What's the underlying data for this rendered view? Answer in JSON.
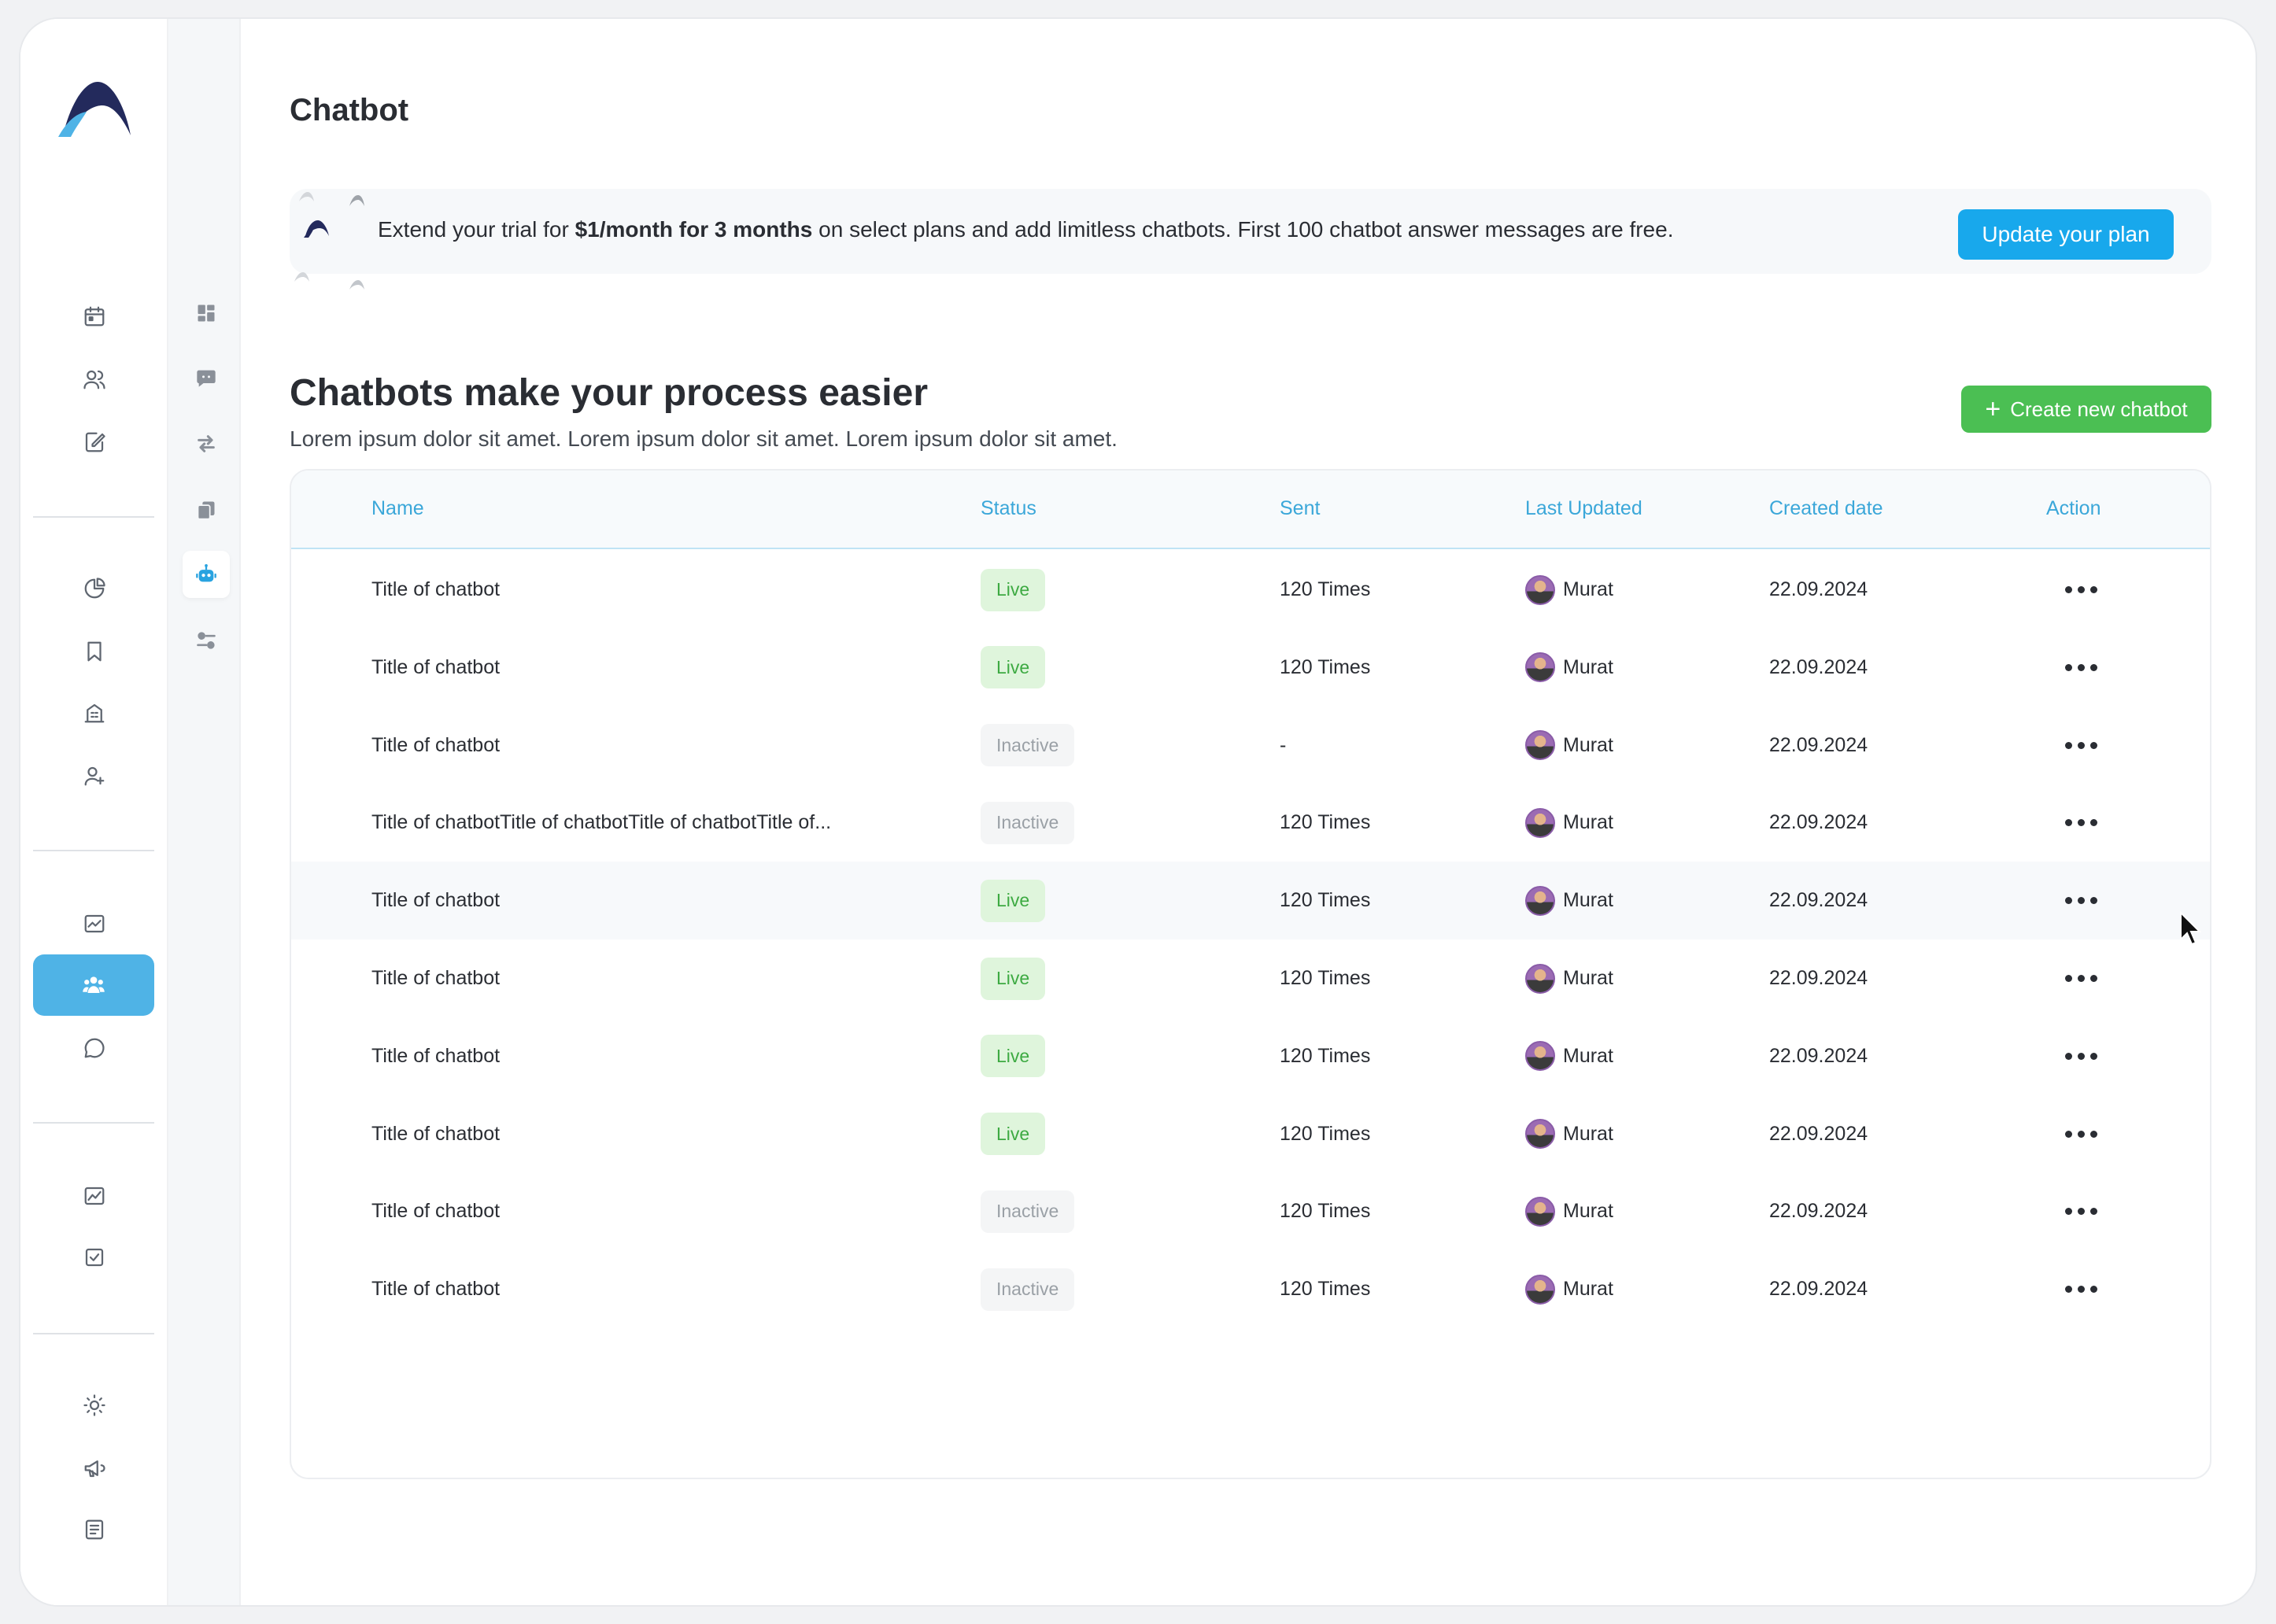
{
  "page": {
    "title": "Chatbot"
  },
  "banner": {
    "text_pre": "Extend your trial for ",
    "text_bold": "$1/month for 3 months",
    "text_post": " on select plans and add limitless chatbots. First 100 chatbot answer messages are free.",
    "button_label": "Update your plan"
  },
  "section": {
    "title": "Chatbots make your process easier",
    "subtitle": "Lorem ipsum dolor sit amet. Lorem ipsum dolor sit amet. Lorem ipsum dolor sit amet.",
    "create_label": "Create new chatbot"
  },
  "table": {
    "columns": [
      "Name",
      "Status",
      "Sent",
      "Last Updated",
      "Created date",
      "Action"
    ],
    "rows": [
      {
        "name": "Title of chatbot",
        "status": "Live",
        "sent": "120 Times",
        "updated_by": "Murat",
        "created": "22.09.2024"
      },
      {
        "name": "Title of chatbot",
        "status": "Live",
        "sent": "120 Times",
        "updated_by": "Murat",
        "created": "22.09.2024"
      },
      {
        "name": "Title of chatbot",
        "status": "Inactive",
        "sent": "-",
        "updated_by": "Murat",
        "created": "22.09.2024"
      },
      {
        "name": "Title of chatbotTitle of chatbotTitle of chatbotTitle of...",
        "status": "Inactive",
        "sent": "120 Times",
        "updated_by": "Murat",
        "created": "22.09.2024"
      },
      {
        "name": "Title of chatbot",
        "status": "Live",
        "sent": "120 Times",
        "updated_by": "Murat",
        "created": "22.09.2024"
      },
      {
        "name": "Title of chatbot",
        "status": "Live",
        "sent": "120 Times",
        "updated_by": "Murat",
        "created": "22.09.2024"
      },
      {
        "name": "Title of chatbot",
        "status": "Live",
        "sent": "120 Times",
        "updated_by": "Murat",
        "created": "22.09.2024"
      },
      {
        "name": "Title of chatbot",
        "status": "Live",
        "sent": "120 Times",
        "updated_by": "Murat",
        "created": "22.09.2024"
      },
      {
        "name": "Title of chatbot",
        "status": "Inactive",
        "sent": "120 Times",
        "updated_by": "Murat",
        "created": "22.09.2024"
      },
      {
        "name": "Title of chatbot",
        "status": "Inactive",
        "sent": "120 Times",
        "updated_by": "Murat",
        "created": "22.09.2024"
      }
    ]
  },
  "sidebar": {
    "icons": [
      "calendar-icon",
      "users-icon",
      "edit-note-icon",
      "pie-chart-icon",
      "bookmark-icon",
      "building-icon",
      "add-user-icon",
      "trend-chart-icon",
      "team-icon",
      "chat-bubble-icon",
      "analytics-icon",
      "checkbox-icon",
      "sun-icon",
      "megaphone-icon",
      "document-icon"
    ],
    "active": "team-icon"
  },
  "subnav": {
    "icons": [
      "dashboard-icon",
      "message-icon",
      "swap-icon",
      "copy-icon",
      "robot-icon",
      "sliders-icon"
    ],
    "active": "robot-icon"
  },
  "colors": {
    "accent": "#4fb3e6",
    "update_button": "#18a8ec",
    "create_button": "#4bbf53",
    "live_bg": "#dff5dc",
    "live_text": "#3daa42",
    "inactive_bg": "#f4f5f6",
    "inactive_text": "#9aa0a6"
  }
}
